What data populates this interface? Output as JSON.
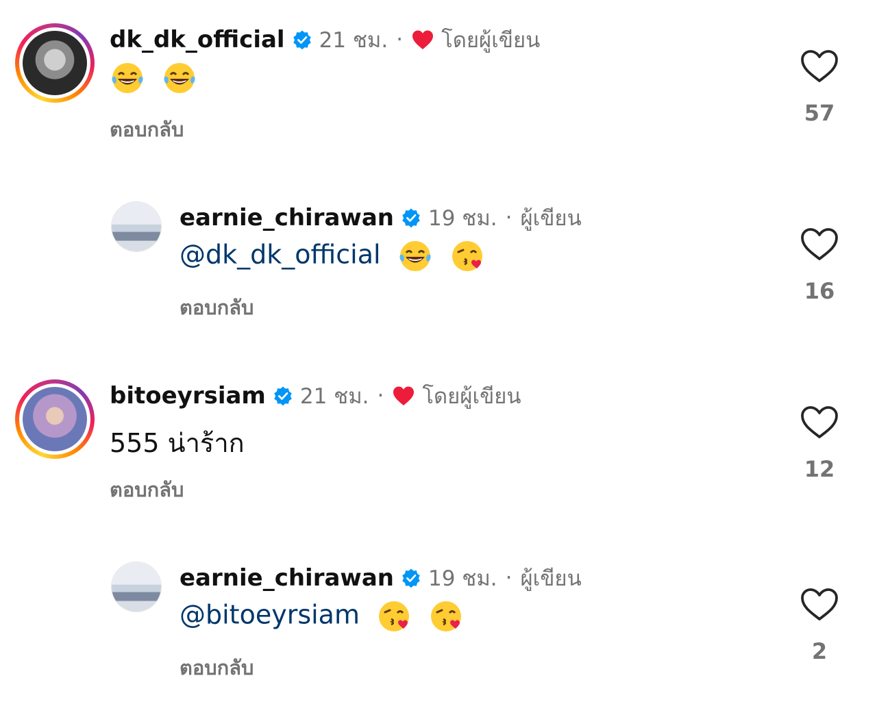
{
  "comments": [
    {
      "username": "dk_dk_official",
      "time": "21 ชม.",
      "separator": "·",
      "liked_by_author_label": "โดยผู้เขียน",
      "text": "",
      "emojis": [
        "laughing-tears",
        "laughing-tears"
      ],
      "reply_label": "ตอบกลับ",
      "likes": "57"
    },
    {
      "username": "earnie_chirawan",
      "time": "19 ชม.",
      "separator": "·",
      "author_label": "ผู้เขียน",
      "mention": "@dk_dk_official",
      "emojis": [
        "laughing-tears",
        "kissing-heart"
      ],
      "reply_label": "ตอบกลับ",
      "likes": "16"
    },
    {
      "username": "bitoeyrsiam",
      "time": "21 ชม.",
      "separator": "·",
      "liked_by_author_label": "โดยผู้เขียน",
      "text": "555 น่าร้าก",
      "reply_label": "ตอบกลับ",
      "likes": "12"
    },
    {
      "username": "earnie_chirawan",
      "time": "19 ชม.",
      "separator": "·",
      "author_label": "ผู้เขียน",
      "mention": "@bitoeyrsiam",
      "emojis": [
        "kissing-heart",
        "kissing-heart"
      ],
      "reply_label": "ตอบกลับ",
      "likes": "2"
    }
  ],
  "colors": {
    "verified": "#0095f6",
    "heart_red": "#ed1c3a",
    "meta_gray": "#737373",
    "mention_blue": "#00376b"
  }
}
